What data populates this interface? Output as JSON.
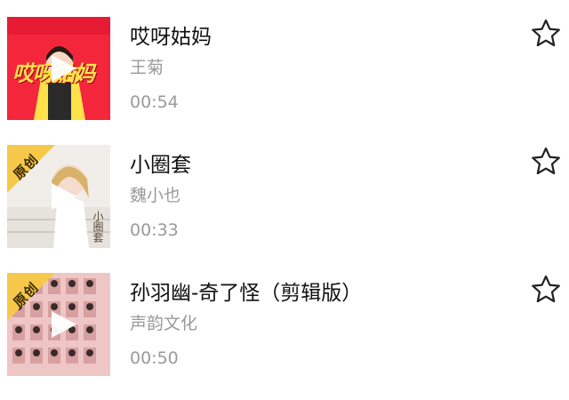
{
  "songs": [
    {
      "title": "哎呀姑妈",
      "artist": "王菊",
      "duration": "00:54",
      "badge": "",
      "cover_text": "哎呀姑妈",
      "cover_colors": {
        "bg": "#f3263c",
        "accent": "#ffe14a"
      }
    },
    {
      "title": "小圈套",
      "artist": "魏小也",
      "duration": "00:33",
      "badge": "原创",
      "cover_text": "小圈套",
      "cover_colors": {
        "bg": "#f1eee9",
        "accent": "#f6c84a"
      }
    },
    {
      "title": "孙羽幽-奇了怪（剪辑版）",
      "artist": "声韵文化",
      "duration": "00:50",
      "badge": "原创",
      "cover_text": "",
      "cover_colors": {
        "bg": "#efc6c6",
        "accent": "#f6c84a"
      }
    }
  ],
  "icons": {
    "play": "play-icon",
    "favorite": "star-outline-icon"
  }
}
